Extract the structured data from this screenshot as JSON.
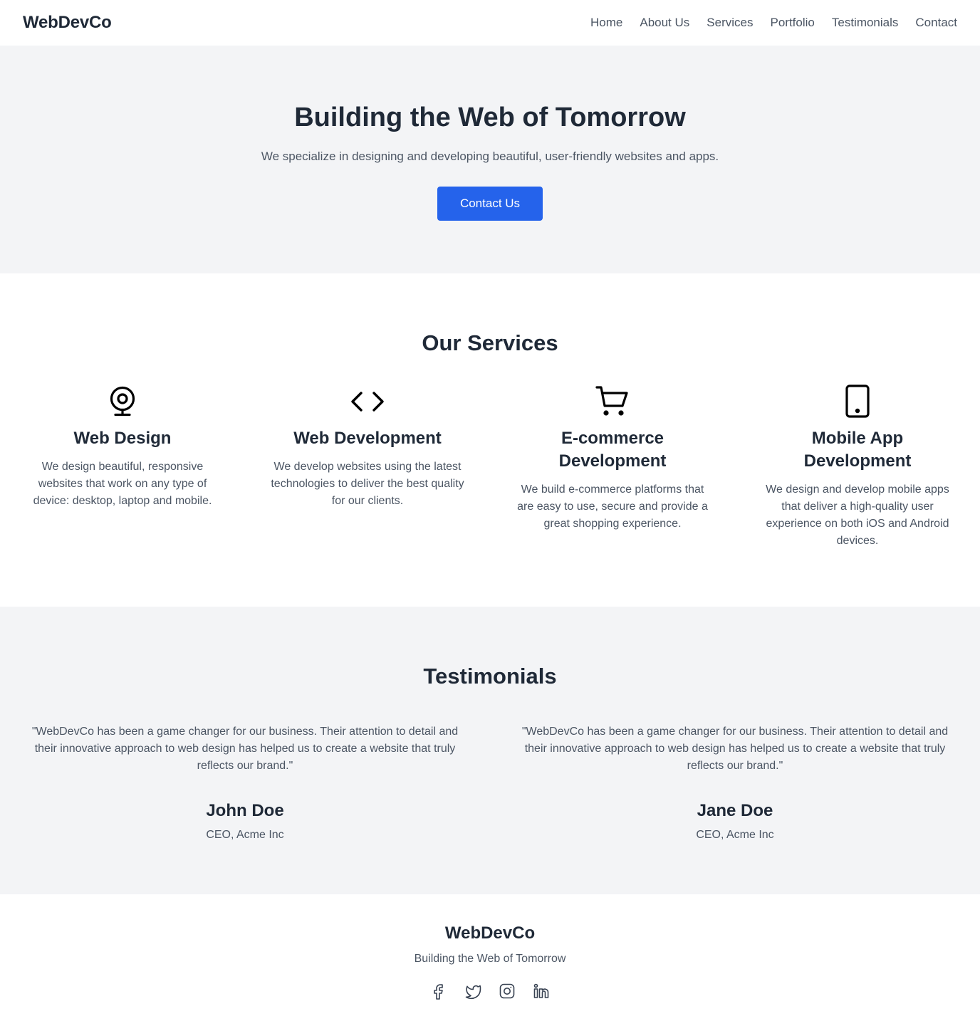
{
  "header": {
    "logo": "WebDevCo",
    "nav": [
      "Home",
      "About Us",
      "Services",
      "Portfolio",
      "Testimonials",
      "Contact"
    ]
  },
  "hero": {
    "title": "Building the Web of Tomorrow",
    "subtitle": "We specialize in designing and developing beautiful, user-friendly websites and apps.",
    "cta": "Contact Us"
  },
  "services": {
    "title": "Our Services",
    "items": [
      {
        "icon": "webcam-icon",
        "title": "Web Design",
        "text": "We design beautiful, responsive websites that work on any type of device: desktop, laptop and mobile."
      },
      {
        "icon": "code-icon",
        "title": "Web Development",
        "text": "We develop websites using the latest technologies to deliver the best quality for our clients."
      },
      {
        "icon": "shopping-cart-icon",
        "title": "E-commerce Development",
        "text": "We build e-commerce platforms that are easy to use, secure and provide a great shopping experience."
      },
      {
        "icon": "mobile-phone-icon",
        "title": "Mobile App Development",
        "text": "We design and develop mobile apps that deliver a high-quality user experience on both iOS and Android devices."
      }
    ]
  },
  "testimonials": {
    "title": "Testimonials",
    "items": [
      {
        "quote": "\"WebDevCo has been a game changer for our business. Their attention to detail and their innovative approach to web design has helped us to create a website that truly reflects our brand.\"",
        "name": "John Doe",
        "role": "CEO, Acme Inc"
      },
      {
        "quote": "\"WebDevCo has been a game changer for our business. Their attention to detail and their innovative approach to web design has helped us to create a website that truly reflects our brand.\"",
        "name": "Jane Doe",
        "role": "CEO, Acme Inc"
      }
    ]
  },
  "footer": {
    "logo": "WebDevCo",
    "tagline": "Building the Web of Tomorrow",
    "social": [
      "facebook-icon",
      "twitter-icon",
      "instagram-icon",
      "linkedin-icon"
    ]
  },
  "colors": {
    "primary": "#2563eb",
    "text_dark": "#1f2937",
    "text_muted": "#4b5563",
    "section_bg": "#f3f4f6"
  }
}
